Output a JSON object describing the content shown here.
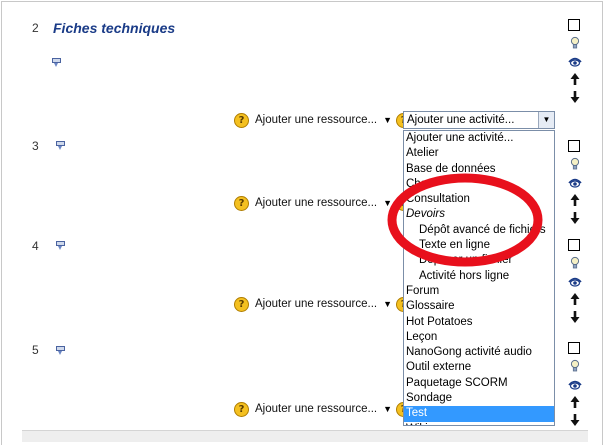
{
  "sections": [
    {
      "number": "2",
      "title": "Fiches techniques"
    },
    {
      "number": "3"
    },
    {
      "number": "4"
    },
    {
      "number": "5"
    }
  ],
  "resource_select": {
    "label": "Ajouter une ressource..."
  },
  "activity_select": {
    "value": "Ajouter une activité..."
  },
  "help_glyph": "?",
  "dropdown_arrow": "▼",
  "activity_options": [
    {
      "label": "Ajouter une activité...",
      "kind": "normal"
    },
    {
      "label": "Atelier",
      "kind": "normal"
    },
    {
      "label": "Base de données",
      "kind": "normal"
    },
    {
      "label": "Chat",
      "kind": "normal"
    },
    {
      "label": "Consultation",
      "kind": "normal"
    },
    {
      "label": "Devoirs",
      "kind": "group"
    },
    {
      "label": "Dépôt avancé de fichiers",
      "kind": "sub"
    },
    {
      "label": "Texte en ligne",
      "kind": "sub"
    },
    {
      "label": "Déposer un fichier",
      "kind": "sub"
    },
    {
      "label": "Activité hors ligne",
      "kind": "sub"
    },
    {
      "label": "Forum",
      "kind": "normal"
    },
    {
      "label": "Glossaire",
      "kind": "normal"
    },
    {
      "label": "Hot Potatoes",
      "kind": "normal"
    },
    {
      "label": "Leçon",
      "kind": "normal"
    },
    {
      "label": "NanoGong activité audio",
      "kind": "normal"
    },
    {
      "label": "Outil externe",
      "kind": "normal"
    },
    {
      "label": "Paquetage SCORM",
      "kind": "normal"
    },
    {
      "label": "Sondage",
      "kind": "normal"
    },
    {
      "label": "Test",
      "kind": "selected"
    },
    {
      "label": "Wiki",
      "kind": "normal"
    }
  ],
  "colors": {
    "section_title": "#1a3b87",
    "selection": "#3399ff",
    "annotation_circle": "#e8101c",
    "help_icon": "#f4c020"
  },
  "icons": [
    "summary-edit-icon",
    "help-icon",
    "checkbox",
    "highlight-bulb-icon",
    "visibility-eye-icon",
    "move-up-arrow-icon",
    "move-down-arrow-icon"
  ]
}
